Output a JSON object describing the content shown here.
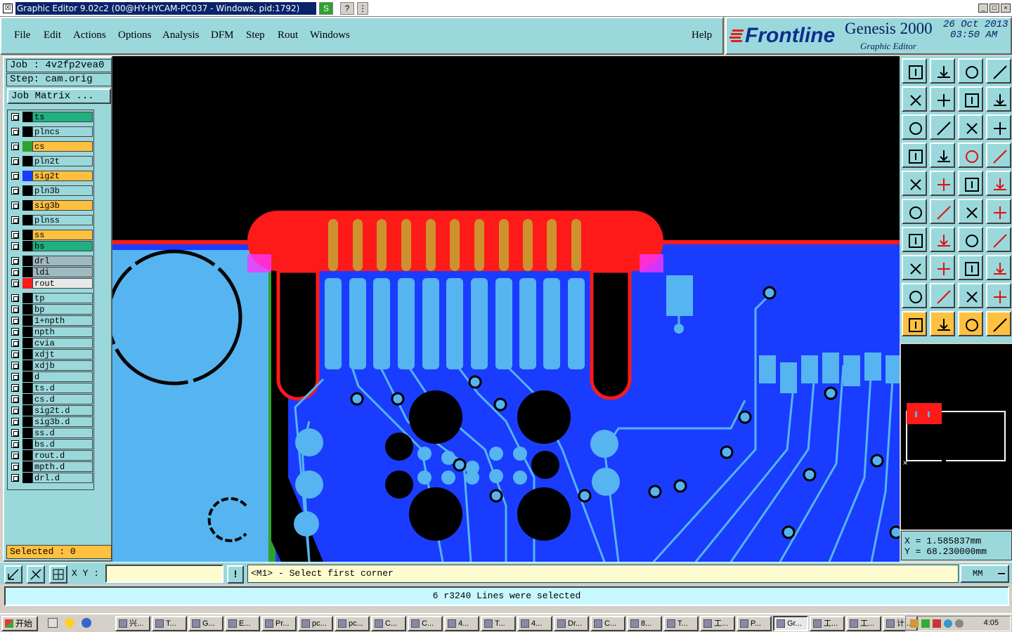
{
  "window": {
    "title": "Graphic Editor 9.02c2 (00@HY-HYCAM-PC037 - Windows, pid:1792)",
    "mini_s": "S",
    "mini_help": "?",
    "mini_menu": "⋮",
    "btn_min": "_",
    "btn_max": "□",
    "btn_close": "×"
  },
  "menu": {
    "items": [
      "File",
      "Edit",
      "Actions",
      "Options",
      "Analysis",
      "DFM",
      "Step",
      "Rout",
      "Windows"
    ],
    "help": "Help"
  },
  "brand": {
    "logo": "Frontline",
    "product": "Genesis 2000",
    "subtitle": "Graphic Editor",
    "date": "26 Oct 2013",
    "time": "03:50 AM"
  },
  "job": {
    "job_label": "Job : 4v2fp2vea0",
    "step_label": "Step: cam.orig",
    "matrix_button": "Job Matrix ..."
  },
  "layers": [
    {
      "name": "ts",
      "color": "#000000",
      "bg": "#20b080"
    },
    {
      "name": "plncs",
      "color": "#000000",
      "bg": "#9ad8dc"
    },
    {
      "name": "cs",
      "color": "#2ea12e",
      "bg": "#ffc040"
    },
    {
      "name": "pln2t",
      "color": "#000000",
      "bg": "#9ad8dc"
    },
    {
      "name": "sig2t",
      "color": "#1a3cff",
      "bg": "#ffc040"
    },
    {
      "name": "pln3b",
      "color": "#000000",
      "bg": "#9ad8dc"
    },
    {
      "name": "sig3b",
      "color": "#000000",
      "bg": "#ffc040"
    },
    {
      "name": "plnss",
      "color": "#000000",
      "bg": "#9ad8dc"
    },
    {
      "name": "ss",
      "color": "#000000",
      "bg": "#ffc040"
    },
    {
      "name": "bs",
      "color": "#000000",
      "bg": "#20b080"
    },
    {
      "name": "drl",
      "color": "#000000",
      "bg": "#a0b8c0"
    },
    {
      "name": "ldi",
      "color": "#000000",
      "bg": "#a0b8c0"
    },
    {
      "name": "rout",
      "color": "#ff1a1a",
      "bg": "#e8e8e8"
    },
    {
      "name": "tp",
      "color": "#000000",
      "bg": "#9ad8dc"
    },
    {
      "name": "bp",
      "color": "#000000",
      "bg": "#9ad8dc"
    },
    {
      "name": "1+npth",
      "color": "#000000",
      "bg": "#9ad8dc"
    },
    {
      "name": "npth",
      "color": "#000000",
      "bg": "#9ad8dc"
    },
    {
      "name": "cvia",
      "color": "#000000",
      "bg": "#9ad8dc"
    },
    {
      "name": "xdjt",
      "color": "#000000",
      "bg": "#9ad8dc"
    },
    {
      "name": "xdjb",
      "color": "#000000",
      "bg": "#9ad8dc"
    },
    {
      "name": "d",
      "color": "#000000",
      "bg": "#9ad8dc"
    },
    {
      "name": "ts.d",
      "color": "#000000",
      "bg": "#9ad8dc"
    },
    {
      "name": "cs.d",
      "color": "#000000",
      "bg": "#9ad8dc"
    },
    {
      "name": "sig2t.d",
      "color": "#000000",
      "bg": "#9ad8dc"
    },
    {
      "name": "sig3b.d",
      "color": "#000000",
      "bg": "#9ad8dc"
    },
    {
      "name": "ss.d",
      "color": "#000000",
      "bg": "#9ad8dc"
    },
    {
      "name": "bs.d",
      "color": "#000000",
      "bg": "#9ad8dc"
    },
    {
      "name": "rout.d",
      "color": "#000000",
      "bg": "#9ad8dc"
    },
    {
      "name": "mpth.d",
      "color": "#000000",
      "bg": "#9ad8dc"
    },
    {
      "name": "drl.d",
      "color": "#000000",
      "bg": "#9ad8dc"
    }
  ],
  "selected_label": "Selected : 0",
  "coords": {
    "x": "X = 1.585837mm",
    "y": "Y = 68.230000mm"
  },
  "command": {
    "xy_label": "X Y :",
    "xy_value": "",
    "info_icon": "!",
    "prompt": "<M1> - Select first corner",
    "units": "MM"
  },
  "status_message": "6 r3240 Lines were selected",
  "taskbar": {
    "start": "开始",
    "tasks": [
      "兴...",
      "T...",
      "G...",
      "E...",
      "Pr...",
      "pc...",
      "pc...",
      "C...",
      "C...",
      "4...",
      "T...",
      "4...",
      "Dr...",
      "C...",
      "8...",
      "T...",
      "工...",
      "P...",
      "Gr...",
      "工...",
      "工...",
      "计..."
    ],
    "active_task": "Gr...",
    "clock": "4:05"
  },
  "colors": {
    "panel": "#9ad8dc",
    "board_fill": "#1a3cff",
    "trace_light": "#56b4f0",
    "rout_red": "#ff1a1a",
    "highlight": "#ffc040"
  }
}
